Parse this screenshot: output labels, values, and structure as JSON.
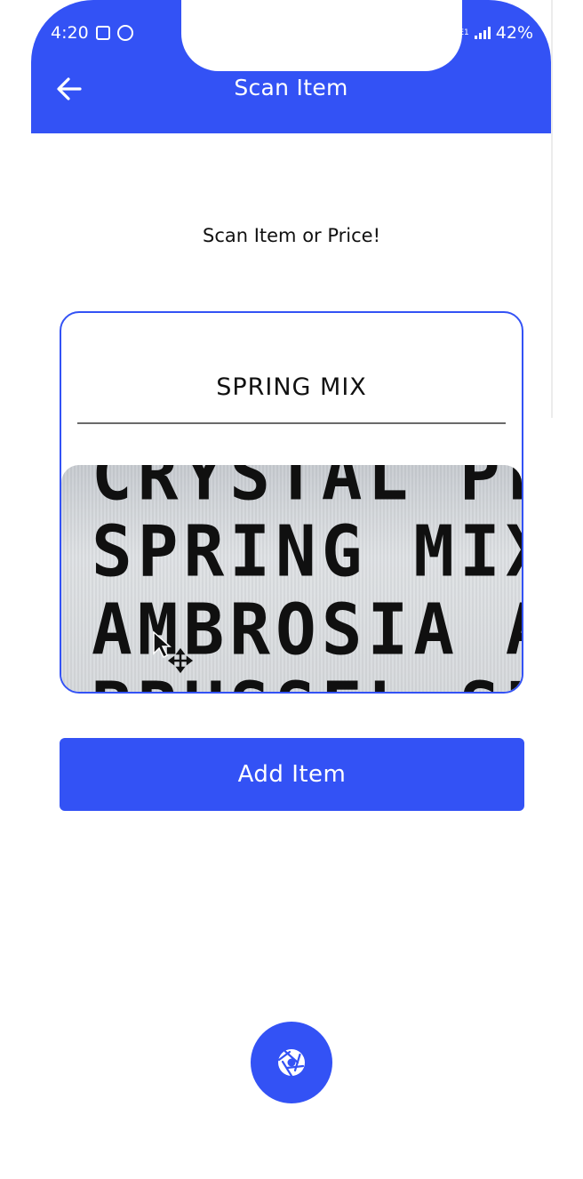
{
  "status_bar": {
    "time": "4:20",
    "network": "LTE1",
    "battery": "42%"
  },
  "header": {
    "title": "Scan Item"
  },
  "main": {
    "prompt": "Scan Item or Price!",
    "scan_result": "SPRING MIX",
    "camera_lines": [
      "CRYSTAL PLU",
      "SPRING MIX",
      "AMBROSIA AP",
      "BRUSSEL SPR"
    ],
    "add_label": "Add Item"
  },
  "colors": {
    "accent": "#3352f5",
    "background": "#ffffff",
    "text": "#111111"
  },
  "icons": {
    "back": "arrow-left-icon",
    "camera": "aperture-icon"
  }
}
